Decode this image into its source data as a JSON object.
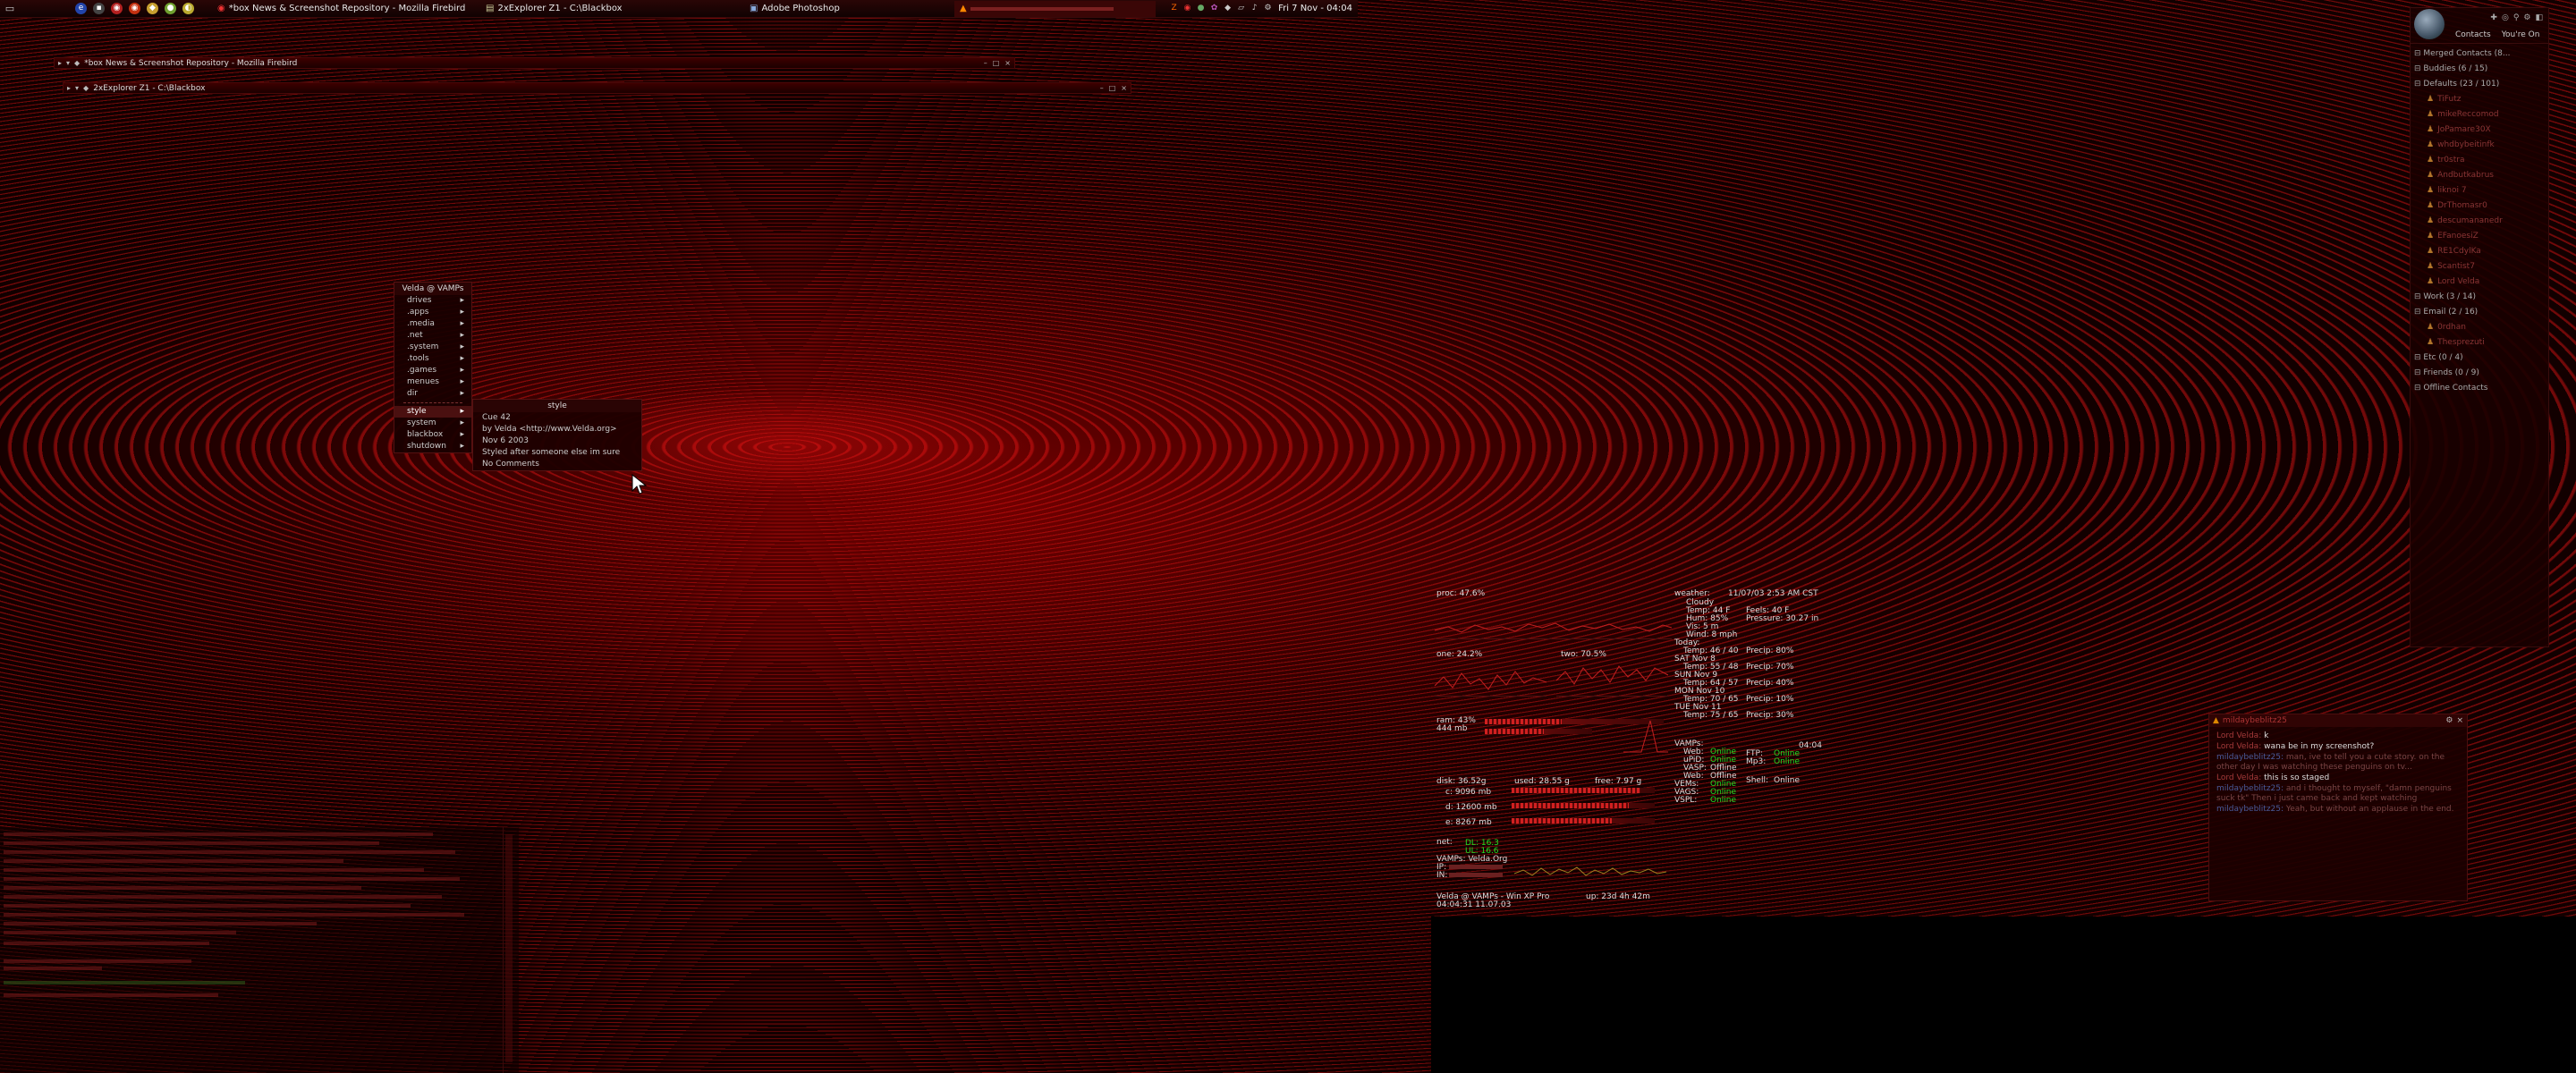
{
  "taskbar": {
    "tasks": [
      {
        "label": "*box News & Screenshot Repository - Mozilla Firebird"
      },
      {
        "label": "2xExplorer Z1 - C:\\Blackbox"
      },
      {
        "label": "Adobe Photoshop"
      }
    ],
    "clock": "Fri 7 Nov - 04:04"
  },
  "windows": {
    "firebird_title": "*box News & Screenshot Repository - Mozilla Firebird",
    "explorer_title": "2xExplorer Z1 - C:\\Blackbox"
  },
  "rootmenu": {
    "title": "Velda @ VAMPs",
    "items": [
      {
        "label": "drives"
      },
      {
        "label": ".apps"
      },
      {
        "label": ".media"
      },
      {
        "label": ".net"
      },
      {
        "label": ".system"
      },
      {
        "label": ".tools"
      },
      {
        "label": ".games"
      },
      {
        "label": "menues"
      },
      {
        "label": "dir"
      }
    ],
    "items2": [
      {
        "label": "style"
      },
      {
        "label": "system"
      },
      {
        "label": "blackbox"
      },
      {
        "label": "shutdown"
      }
    ]
  },
  "submenu": {
    "title": "style",
    "items": [
      {
        "label": "Cue 42"
      },
      {
        "label": "by Velda <http://www.Velda.org>"
      },
      {
        "label": "Nov 6 2003"
      },
      {
        "label": "Styled after someone else im sure"
      },
      {
        "label": "No Comments"
      }
    ]
  },
  "sysmon": {
    "proc": "proc: 47.6%",
    "one": "one: 24.2%",
    "two": "two: 70.5%",
    "ram": "ram: 43%",
    "ram_mb": "444 mb",
    "disk": "disk: 36.52g",
    "used": "used: 28.55 g",
    "free": "free: 7.97 g",
    "c": "c: 9096 mb",
    "d": "d: 12600 mb",
    "e": "e: 8267 mb",
    "net": "net:",
    "dl": "DL: 16.3",
    "ul": "UL: 16.6",
    "host": "VAMPs: Velda.Org",
    "ip": "IP:",
    "in": "IN:",
    "footer_user": "Velda @ VAMPs - Win XP Pro",
    "footer_time": "04:04:31 11.07.03",
    "uptime": "up: 23d 4h 42m",
    "weather": {
      "label": "weather:",
      "date": "11/07/03 2:53 AM CST",
      "cond": "Cloudy",
      "temp": "Temp: 44 F",
      "hum": "Hum: 85%",
      "vis": "Vis: 5 m",
      "wind": "Wind: 8 mph",
      "feels": "Feels: 40 F",
      "pressure": "Pressure: 30.27 in",
      "forecast": [
        {
          "day": "Today:",
          "temp": "Temp: 46 / 40",
          "precip": "Precip: 80%"
        },
        {
          "day": "SAT    Nov 8",
          "temp": "Temp: 55 / 48",
          "precip": "Precip: 70%"
        },
        {
          "day": "SUN    Nov 9",
          "temp": "Temp: 64 / 57",
          "precip": "Precip: 40%"
        },
        {
          "day": "MON    Nov 10",
          "temp": "Temp: 70 / 65",
          "precip": "Precip: 10%"
        },
        {
          "day": "TUE    Nov 11",
          "temp": "Temp: 75 / 65",
          "precip": "Precip: 30%"
        }
      ]
    },
    "services_time": "04:04",
    "services": [
      {
        "name": "VAMPs:",
        "val": ""
      },
      {
        "name": "Web:",
        "val": "Online"
      },
      {
        "name": "uPiD:",
        "val": "Online"
      },
      {
        "name": "VASP:",
        "val": "Offline"
      },
      {
        "name": "Web:",
        "val": "Offline"
      },
      {
        "name": "VEMs:",
        "val": "Online"
      },
      {
        "name": "VAGS:",
        "val": "Online"
      },
      {
        "name": "VSPL:",
        "val": "Online"
      }
    ],
    "ftp": "FTP:",
    "ftp_val": "Online",
    "mp3": "Mp3:",
    "mp3_val": "Online",
    "shell": "Shell:",
    "shell_val": "Online"
  },
  "contacts": {
    "tab_contacts": "Contacts",
    "tab_you": "You're On",
    "groups": [
      {
        "type": "group",
        "label": "Merged Contacts (8..."
      },
      {
        "type": "group",
        "label": "Buddies (6 / 15)"
      },
      {
        "type": "group",
        "label": "Defaults (23 / 101)"
      },
      {
        "type": "person",
        "label": "TiFutz"
      },
      {
        "type": "person",
        "label": "mikeReccomod"
      },
      {
        "type": "person",
        "label": "JoPamare30X"
      },
      {
        "type": "person",
        "label": "whdbybeitinfk"
      },
      {
        "type": "person",
        "label": "tr0stra"
      },
      {
        "type": "person",
        "label": "Andbutkabrus"
      },
      {
        "type": "person",
        "label": "liknoi 7"
      },
      {
        "type": "person",
        "label": "DrThomasr0"
      },
      {
        "type": "person",
        "label": "descumananedr"
      },
      {
        "type": "person",
        "label": "EFanoesiZ"
      },
      {
        "type": "person",
        "label": "RE1CdylKa"
      },
      {
        "type": "person",
        "label": "Scantist7"
      },
      {
        "type": "person",
        "label": "Lord Velda"
      },
      {
        "type": "group",
        "label": "Work (3 / 14)"
      },
      {
        "type": "group",
        "label": "Email (2 / 16)"
      },
      {
        "type": "person",
        "label": "0rdhan"
      },
      {
        "type": "person",
        "label": "Thesprezuti"
      },
      {
        "type": "group",
        "label": "Etc (0 / 4)"
      },
      {
        "type": "group",
        "label": "Friends (0 / 9)"
      },
      {
        "type": "group",
        "label": "Offline Contacts"
      }
    ]
  },
  "chat": {
    "title": "mildaybeblitz25",
    "lines": [
      {
        "nick": "Lord Velda:",
        "text": "k",
        "dim": false
      },
      {
        "nick": "Lord Velda:",
        "text": "wana be in my screenshot?",
        "dim": false
      },
      {
        "nick": "mildaybeblitz25:",
        "text": "man, ive to tell you a cute story. on the other day I was watching these penguins on tv...",
        "dim": true,
        "b": true
      },
      {
        "nick": "Lord Velda:",
        "text": "this is so staged",
        "dim": false
      },
      {
        "nick": "mildaybeblitz25:",
        "text": "and i thought to myself, \"damn penguins suck tk\" Then i just came back and kept watching",
        "dim": true,
        "b": true
      },
      {
        "nick": "mildaybeblitz25:",
        "text": "Yeah, but without an applause in the end.",
        "dim": true,
        "b": true
      }
    ]
  }
}
